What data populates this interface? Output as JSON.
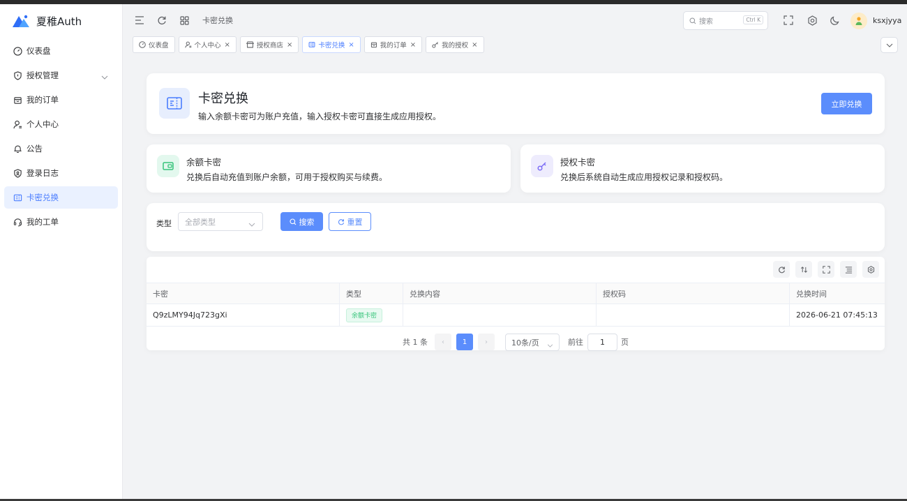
{
  "app": {
    "name": "夏稚Auth"
  },
  "sidebar": {
    "items": [
      {
        "label": "仪表盘",
        "icon": "dashboard-icon"
      },
      {
        "label": "授权管理",
        "icon": "shield-icon"
      },
      {
        "label": "我的订单",
        "icon": "bag-icon"
      },
      {
        "label": "个人中心",
        "icon": "user-icon"
      },
      {
        "label": "公告",
        "icon": "bell-icon"
      },
      {
        "label": "登录日志",
        "icon": "login-log-icon"
      },
      {
        "label": "卡密兑换",
        "icon": "ticket-icon"
      },
      {
        "label": "我的工单",
        "icon": "headset-icon"
      }
    ]
  },
  "header": {
    "breadcrumb": "卡密兑换",
    "search_placeholder": "搜索",
    "search_shortcut": "Ctrl K",
    "username": "ksxjyya"
  },
  "tabs": [
    {
      "label": "仪表盘",
      "closable": false
    },
    {
      "label": "个人中心",
      "closable": true
    },
    {
      "label": "授权商店",
      "closable": true
    },
    {
      "label": "卡密兑换",
      "closable": true,
      "active": true
    },
    {
      "label": "我的订单",
      "closable": true
    },
    {
      "label": "我的授权",
      "closable": true
    }
  ],
  "hero": {
    "title": "卡密兑换",
    "subtitle": "输入余额卡密可为账户充值，输入授权卡密可直接生成应用授权。",
    "button": "立即兑换"
  },
  "info_cards": [
    {
      "title": "余额卡密",
      "desc": "兑换后自动充值到账户余额，可用于授权购买与续费。",
      "color": "#36c47a"
    },
    {
      "title": "授权卡密",
      "desc": "兑换后系统自动生成应用授权记录和授权码。",
      "color": "#7b6cf6"
    }
  ],
  "filter": {
    "type_label": "类型",
    "type_placeholder": "全部类型",
    "search_button": "搜索",
    "reset_button": "重置"
  },
  "table": {
    "columns": [
      "卡密",
      "类型",
      "兑换内容",
      "授权码",
      "兑换时间"
    ],
    "rows": [
      {
        "card": "Q9zLMY94Jq723gXi",
        "type": "余额卡密",
        "content": "",
        "code": "",
        "time": "2026-06-21 07:45:13"
      }
    ]
  },
  "pagination": {
    "total_text": "共 1 条",
    "current_page": "1",
    "page_size": "10条/页",
    "goto_label": "前往",
    "goto_value": "1",
    "page_unit": "页"
  },
  "colors": {
    "primary": "#5b8dfc",
    "success": "#36c47a",
    "accent": "#4a7dff"
  }
}
